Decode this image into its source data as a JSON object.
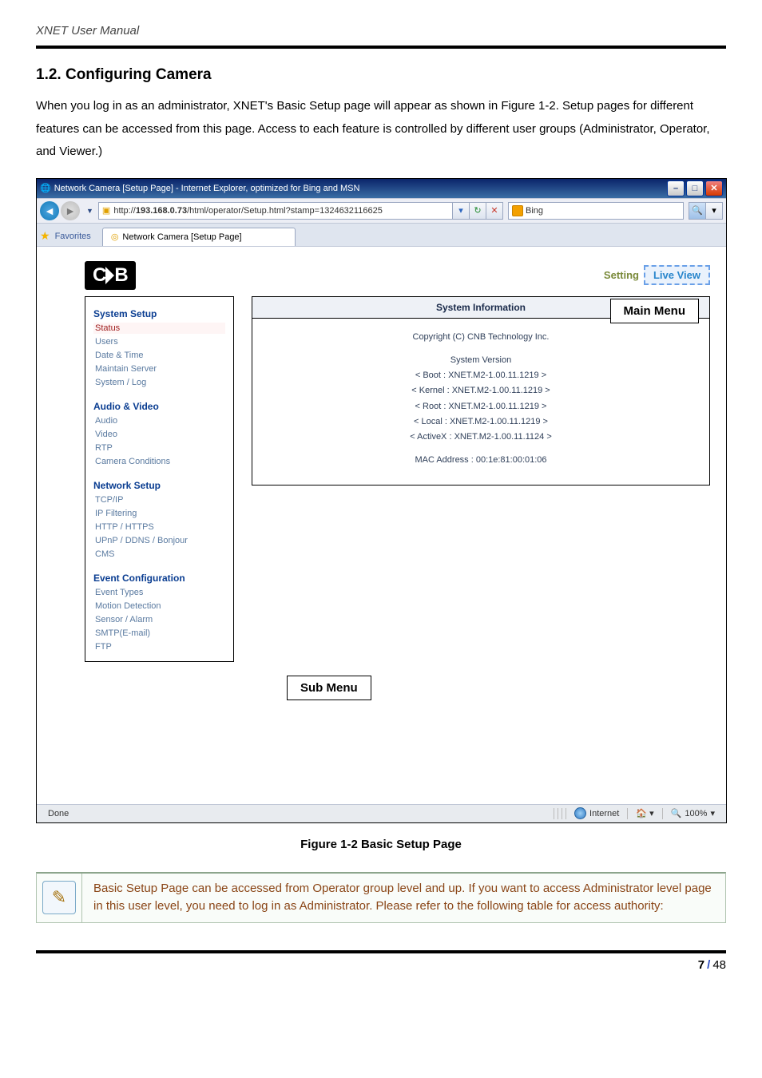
{
  "doc": {
    "running_head": "XNET User Manual",
    "section_title": "1.2. Configuring Camera",
    "paragraph": "When you log in as an administrator, XNET's Basic Setup page will appear as shown in Figure 1-2. Setup pages for different features can be accessed from this page. Access to each feature is controlled by different user groups (Administrator, Operator, and Viewer.)",
    "figure_caption": "Figure 1-2 Basic Setup Page",
    "note_text": "Basic Setup Page can be accessed from Operator group level and up. If you want to access Administrator level page in this user level, you need to log in as Administrator. Please refer to the following table for access authority:",
    "page_num": "7",
    "page_total": "48"
  },
  "win": {
    "title": "Network Camera [Setup Page] - Internet Explorer, optimized for Bing and MSN",
    "url_pre": "http://",
    "url_host": "193.168.0.73",
    "url_rest": "/html/operator/Setup.html?stamp=1324632116625",
    "search_engine": "Bing",
    "favorites": "Favorites",
    "tab_title": "Network Camera [Setup Page]",
    "status_done": "Done",
    "status_zone": "Internet",
    "status_zoom": "100%"
  },
  "app": {
    "logo_text": "CNB",
    "setting": "Setting",
    "liveview": "Live View",
    "callout_main": "Main Menu",
    "callout_sub": "Sub Menu",
    "sidebar": {
      "g1_title": "System Setup",
      "g1_items": [
        "Status",
        "Users",
        "Date & Time",
        "Maintain Server",
        "System / Log"
      ],
      "g2_title": "Audio & Video",
      "g2_items": [
        "Audio",
        "Video",
        "RTP",
        "Camera Conditions"
      ],
      "g3_title": "Network Setup",
      "g3_items": [
        "TCP/IP",
        "IP Filtering",
        "HTTP / HTTPS",
        "UPnP / DDNS / Bonjour",
        "CMS"
      ],
      "g4_title": "Event Configuration",
      "g4_items": [
        "Event Types",
        "Motion Detection",
        "Sensor / Alarm",
        "SMTP(E-mail)",
        "FTP"
      ]
    },
    "content": {
      "head": "System Information",
      "copyright": "Copyright (C) CNB Technology Inc.",
      "sv_label": "System Version",
      "boot": "< Boot    : XNET.M2-1.00.11.1219 >",
      "kernel": "< Kernel : XNET.M2-1.00.11.1219 >",
      "root": "< Root    : XNET.M2-1.00.11.1219 >",
      "local": "< Local   : XNET.M2-1.00.11.1219 >",
      "activex": "< ActiveX : XNET.M2-1.00.11.1124 >",
      "mac": "MAC Address : 00:1e:81:00:01:06"
    }
  }
}
